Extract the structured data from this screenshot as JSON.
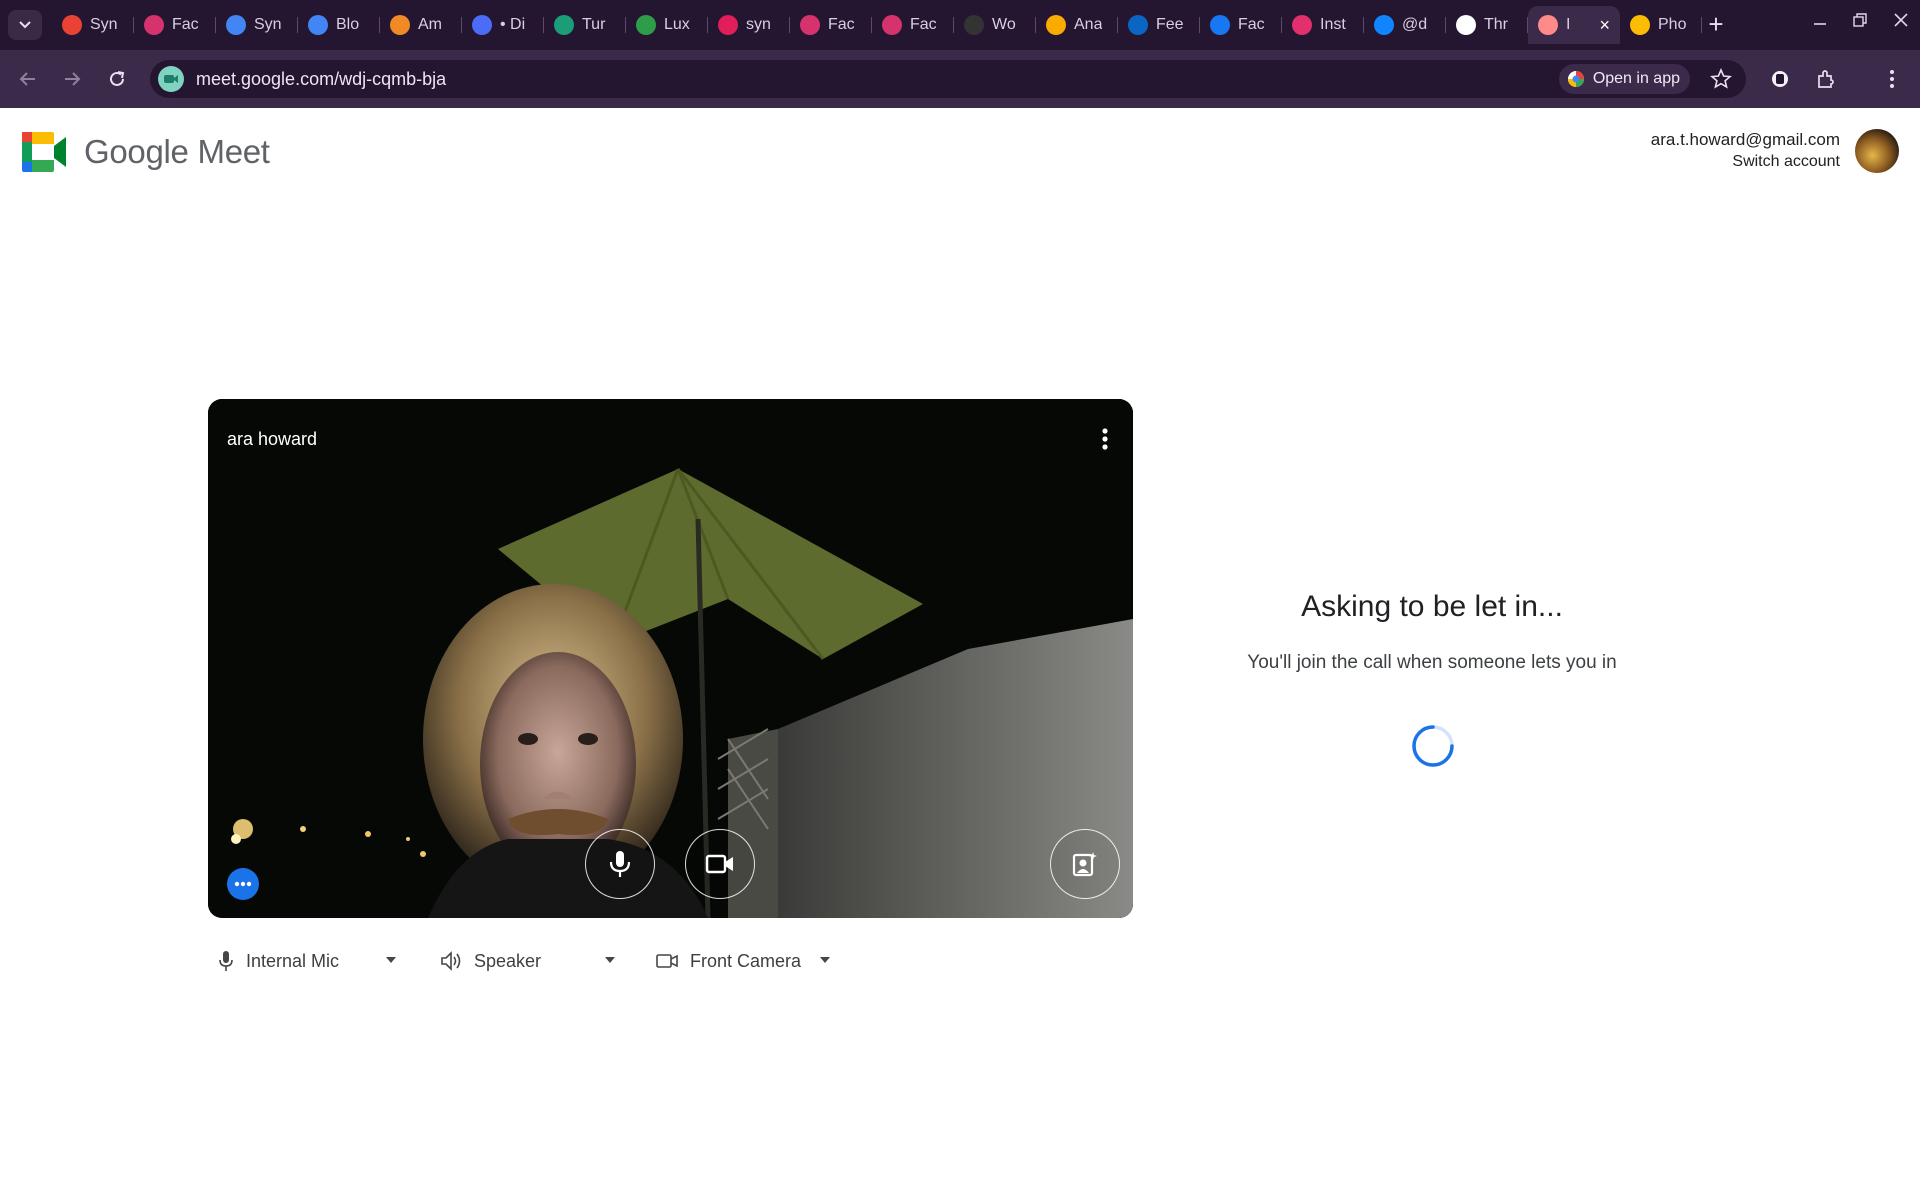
{
  "browser": {
    "tabs": [
      {
        "label": "Syn",
        "icon": "gmail-icon",
        "color": "#ea4335"
      },
      {
        "label": "Fac",
        "icon": "at-sign-icon",
        "color": "#d6336c"
      },
      {
        "label": "Syn",
        "icon": "google-docs-icon",
        "color": "#4285f4"
      },
      {
        "label": "Blo",
        "icon": "google-docs-icon",
        "color": "#4285f4"
      },
      {
        "label": "Am",
        "icon": "cube-icon",
        "color": "#f08a24"
      },
      {
        "label": "• Di",
        "icon": "chat-icon",
        "color": "#4a6cf7"
      },
      {
        "label": "Tur",
        "icon": "mascot-icon",
        "color": "#1b9e77"
      },
      {
        "label": "Lux",
        "icon": "plus-circle-icon",
        "color": "#2e9d4a"
      },
      {
        "label": "syn",
        "icon": "slack-icon",
        "color": "#e01e5a"
      },
      {
        "label": "Fac",
        "icon": "at-sign-icon",
        "color": "#d6336c"
      },
      {
        "label": "Fac",
        "icon": "at-sign-icon",
        "color": "#d6336c"
      },
      {
        "label": "Wo",
        "icon": "circle-outline-icon",
        "color": "#333333"
      },
      {
        "label": "Ana",
        "icon": "analytics-icon",
        "color": "#f9ab00"
      },
      {
        "label": "Fee",
        "icon": "linkedin-icon",
        "color": "#0a66c2"
      },
      {
        "label": "Fac",
        "icon": "facebook-icon",
        "color": "#1877f2"
      },
      {
        "label": "Inst",
        "icon": "instagram-icon",
        "color": "#e1306c"
      },
      {
        "label": "@d",
        "icon": "bluesky-icon",
        "color": "#1185fe"
      },
      {
        "label": "Thr",
        "icon": "threads-icon",
        "color": "#ffffff"
      },
      {
        "label": "I",
        "icon": "record-icon",
        "color": "#ff8a8a",
        "active": true
      },
      {
        "label": "Pho",
        "icon": "google-photos-icon",
        "color": "#fbbc04"
      }
    ],
    "new_tab": "+",
    "url": "meet.google.com/wdj-cqmb-bja",
    "open_in_app": "Open in app"
  },
  "header": {
    "brand_google": "Google",
    "brand_meet": "Meet",
    "account_email": "ara.t.howard@gmail.com",
    "switch_account": "Switch account"
  },
  "preview": {
    "participant_name": "ara howard"
  },
  "devices": {
    "mic": "Internal Mic",
    "speaker": "Speaker",
    "camera": "Front Camera"
  },
  "status": {
    "title": "Asking to be let in...",
    "subtitle": "You'll join the call when someone lets you in"
  },
  "colors": {
    "accent_blue": "#1a73e8",
    "chrome_dark": "#241530",
    "chrome_toolbar": "#3b2a4a"
  }
}
